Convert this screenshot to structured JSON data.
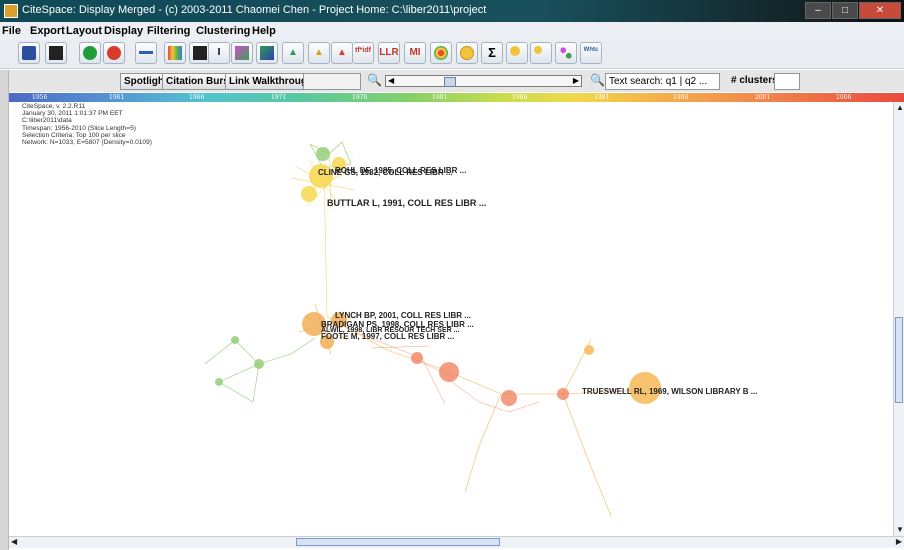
{
  "window": {
    "title": "CiteSpace: Display Merged - (c) 2003-2011 Chaomei Chen - Project Home: C:\\liber2011\\project"
  },
  "menu": [
    "File",
    "Export",
    "Layout",
    "Display",
    "Filtering",
    "Clustering",
    "Help"
  ],
  "toolbar_icons": [
    "save-icon",
    "movie-icon",
    "play-icon",
    "stop-icon",
    "minus-icon",
    "color-grid-icon",
    "text-height-icon",
    "text-cursor-icon",
    "cluster-icon",
    "cluster-alt-icon",
    "triangle-green-icon",
    "triangle-yellow-icon",
    "triangle-red-icon",
    "tfidf-icon",
    "llr-icon",
    "mi-icon",
    "target-icon",
    "circle-yellow-icon",
    "sigma-icon",
    "search-yellow-icon",
    "search-multi-icon",
    "nodes-icon",
    "wc-icon"
  ],
  "toolbar_text": {
    "tfidf": "tf*idf",
    "llr": "LLR",
    "mi": "MI",
    "sigma": "Σ",
    "wc": "Whtc"
  },
  "controls": {
    "spotlight": "Spotlight",
    "citation_burst": "Citation Burst",
    "link_walkthrough": "Link Walkthrough",
    "text_search_label": "Text search: q1 | q2 ...",
    "clusters_label": "# clusters"
  },
  "timeline_years": [
    "1956",
    "1961",
    "1966",
    "1971",
    "1976",
    "1981",
    "1986",
    "1991",
    "1996",
    "2001",
    "2006"
  ],
  "info_lines": [
    "CiteSpace, v. 2.2.R11",
    "January 30, 2011 1:01:37 PM EET",
    "C:\\liber2011\\data",
    "Timespan: 1956-2010 (Slice Length=5)",
    "Selection Criteria: Top 100 per slice",
    "Network: N=1033, E=5807 (Density=0.0109)"
  ],
  "node_labels": [
    "CLINE GS, 1982, COLL RES LIBR ...",
    "ROHL DF, 1985, COLL RES LIBR ...",
    "BUTTLAR L, 1991, COLL RES LIBR ...",
    "LYNCH BP, 2001, COLL RES LIBR ...",
    "BRADIGAN PS, 1998, COLL RES LIBR ...",
    "ALWIL, 1998, LIBR RESOUR TECH SER ...",
    "FOOTE M, 1997, COLL RES LIBR ...",
    "TRUESWELL RL, 1969, WILSON LIBRARY B ..."
  ],
  "colors": {
    "title_bar": "#0f4a56",
    "menu_bg": "#ecf0f5",
    "toolbar_bg": "#e9edf2",
    "scroll_thumb": "#d5e3f4"
  }
}
